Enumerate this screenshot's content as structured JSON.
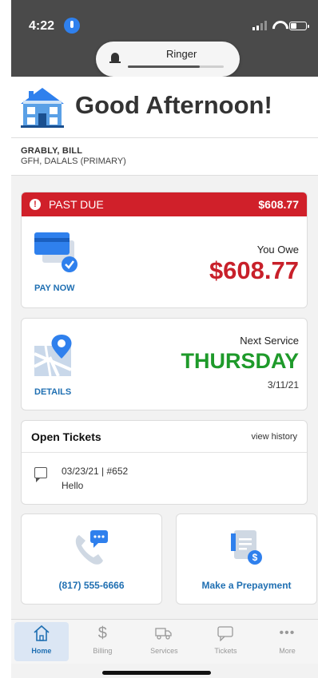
{
  "status_bar": {
    "time": "4:22",
    "signal_bars": 2,
    "battery_level": 0.35
  },
  "ringer": {
    "label": "Ringer",
    "level": 0.75
  },
  "header": {
    "greeting": "Good Afternoon!"
  },
  "account": {
    "name": "GRABLY, BILL",
    "address": "GFH, DALALS (PRIMARY)"
  },
  "billing": {
    "status": "PAST DUE",
    "banner_amount": "$608.77",
    "you_owe_label": "You Owe",
    "amount": "$608.77",
    "pay_now": "PAY NOW"
  },
  "service": {
    "details": "DETAILS",
    "label": "Next Service",
    "day": "THURSDAY",
    "date": "3/11/21"
  },
  "tickets": {
    "title": "Open Tickets",
    "view_history": "view history",
    "items": [
      {
        "header": "03/23/21 | #652",
        "message": "Hello"
      }
    ]
  },
  "tiles": {
    "phone": "(817) 555-6666",
    "prepay": "Make a Prepayment"
  },
  "tabs": [
    {
      "label": "Home",
      "icon": "home-icon"
    },
    {
      "label": "Billing",
      "icon": "dollar-icon"
    },
    {
      "label": "Services",
      "icon": "truck-icon"
    },
    {
      "label": "Tickets",
      "icon": "chat-icon"
    },
    {
      "label": "More",
      "icon": "more-icon"
    }
  ],
  "colors": {
    "past_due_red": "#d0202a",
    "service_green": "#1e9a2a",
    "link_blue": "#1f6fb2",
    "icon_blue": "#2f80ed"
  }
}
